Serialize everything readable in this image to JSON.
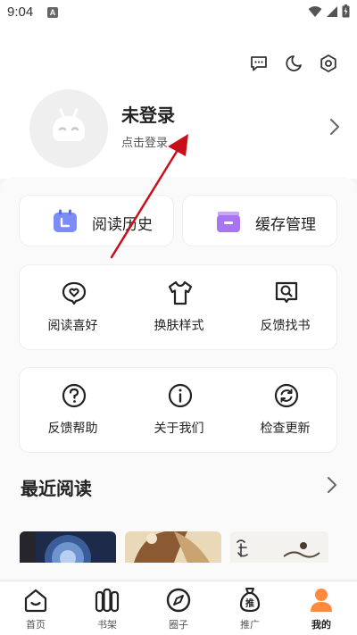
{
  "status_bar": {
    "time": "9:04",
    "notif_letter": "A"
  },
  "header": {
    "icons": [
      "message-icon",
      "moon-icon",
      "settings-icon"
    ]
  },
  "profile": {
    "name": "未登录",
    "hint": "点击登录"
  },
  "quick_actions": [
    {
      "label": "阅读历史",
      "icon": "calendar-icon"
    },
    {
      "label": "缓存管理",
      "icon": "folder-icon"
    }
  ],
  "grid_row_1": [
    {
      "label": "阅读喜好",
      "icon": "heart-chat-icon"
    },
    {
      "label": "换肤样式",
      "icon": "shirt-icon"
    },
    {
      "label": "反馈找书",
      "icon": "search-doc-icon"
    }
  ],
  "grid_row_2": [
    {
      "label": "反馈帮助",
      "icon": "help-icon"
    },
    {
      "label": "关于我们",
      "icon": "info-icon"
    },
    {
      "label": "检查更新",
      "icon": "refresh-icon"
    }
  ],
  "recent": {
    "title": "最近阅读"
  },
  "bottom_nav": [
    {
      "label": "首页",
      "icon": "home-icon"
    },
    {
      "label": "书架",
      "icon": "bookshelf-icon"
    },
    {
      "label": "圈子",
      "icon": "compass-icon"
    },
    {
      "label": "推广",
      "icon": "promote-bag-icon",
      "badge": "推"
    },
    {
      "label": "我的",
      "icon": "user-icon",
      "active": true
    }
  ],
  "colors": {
    "accent": "#ff8a3d",
    "arrow": "#c8101a",
    "calendar": "#7b8cf7",
    "folder": "#a874f3"
  }
}
